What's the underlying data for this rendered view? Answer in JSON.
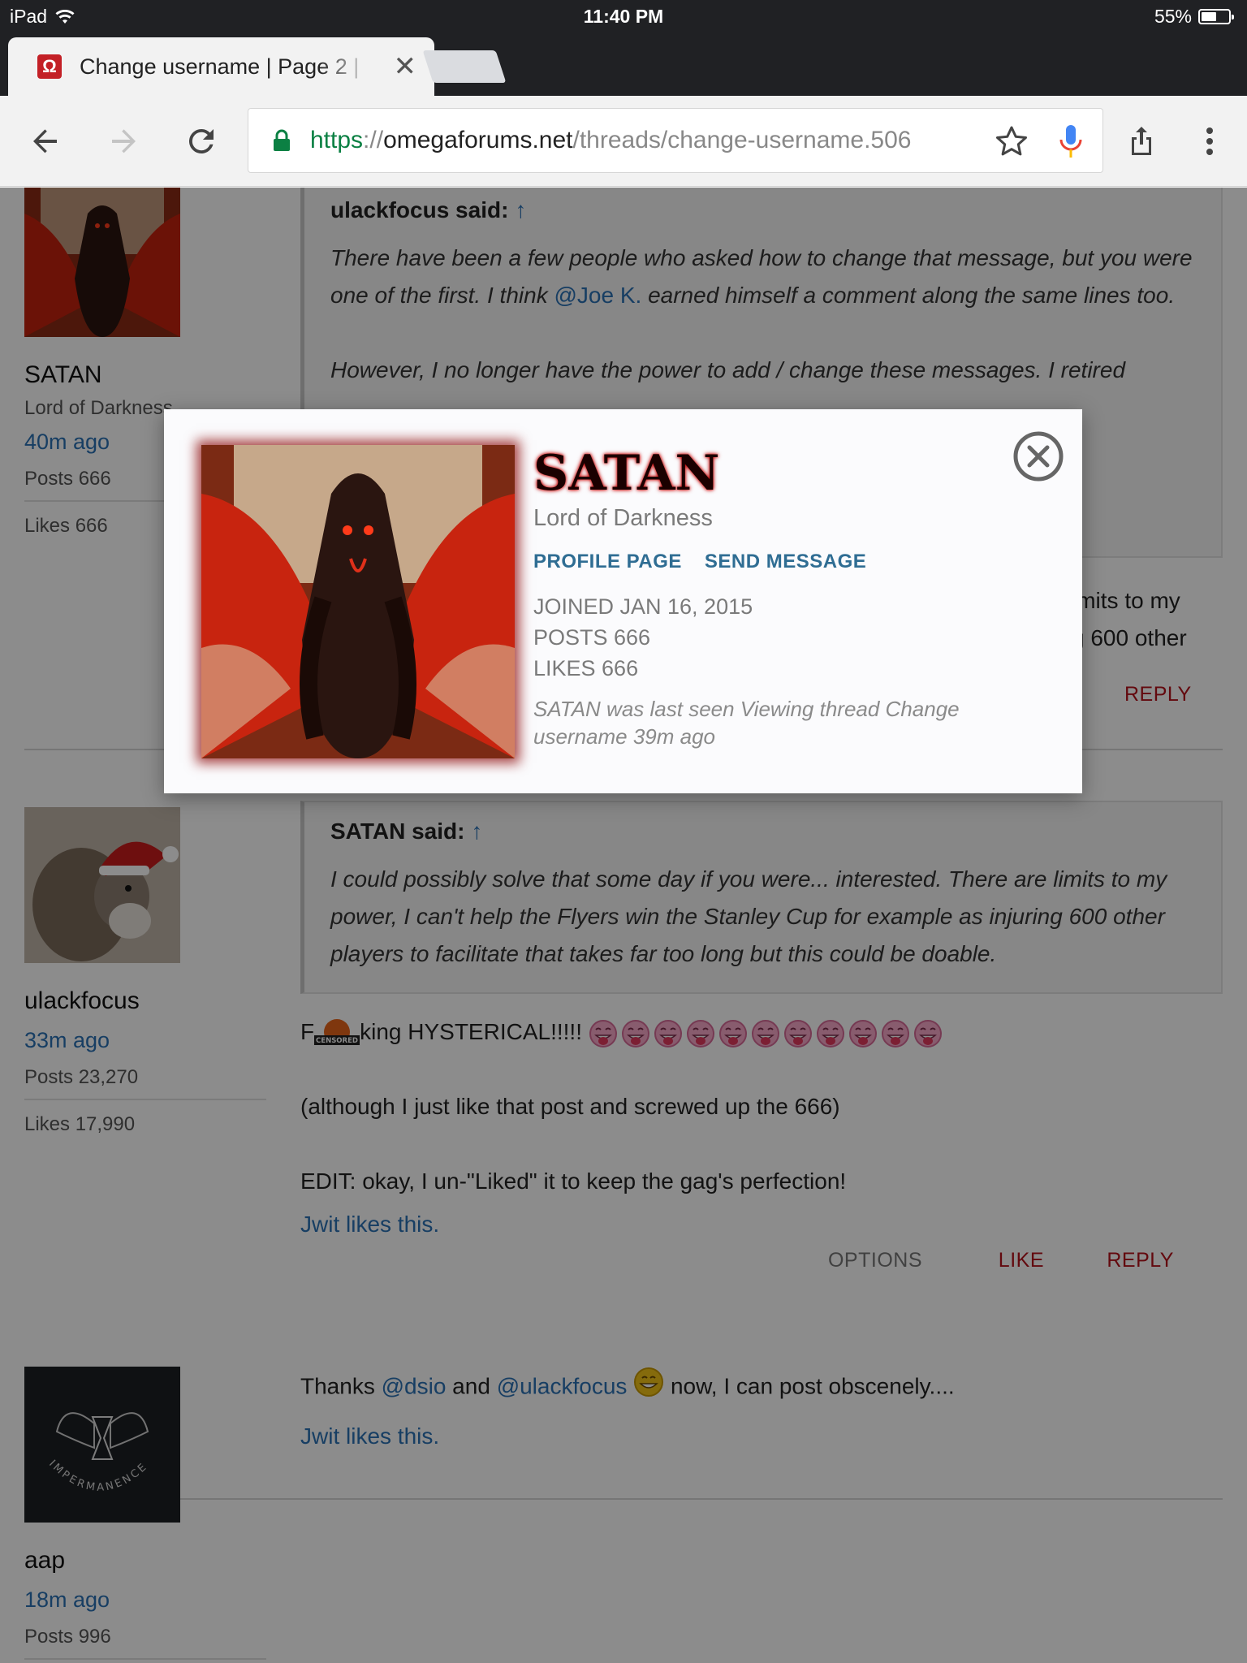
{
  "status_bar": {
    "device": "iPad",
    "time": "11:40 PM",
    "battery": "55%",
    "battery_level": 0.55
  },
  "browser": {
    "tab_title": "Change username | Page 2 |",
    "favicon": "Ω",
    "url_scheme": "https",
    "url_sep": "://",
    "url_host": "omegaforums.net",
    "url_path": "/threads/change-username.506"
  },
  "posts": [
    {
      "user": {
        "name": "SATAN",
        "title": "Lord of Darkness",
        "seen": "40m ago",
        "posts": "Posts 666",
        "likes": "Likes 666"
      },
      "quote": {
        "author": "ulackfocus said:",
        "arrow": "↑",
        "text_a": "There have been a few people who asked how to change that message, but you were one of the first. I think ",
        "mention": "@Joe K.",
        "text_b": " earned himself a comment along the same lines too.",
        "text_c": "However, I no longer have the power to add / change these messages. I retired"
      },
      "partial_line_1": "imits to my",
      "partial_line_2": "g 600 other",
      "reply": "REPLY"
    },
    {
      "user": {
        "name": "ulackfocus",
        "seen": "33m ago",
        "posts": "Posts 23,270",
        "likes": "Likes 17,990"
      },
      "quote": {
        "author": "SATAN said:",
        "arrow": "↑",
        "text": "I could possibly solve that some day if you were... interested. There are limits to my power, I can't help the Flyers win the Stanley Cup for example as injuring 600 other players to facilitate that takes far too long but this could be doable."
      },
      "line1_a": "F",
      "line1_badge": "CENSORED",
      "line1_b": "king HYSTERICAL!!!!!",
      "line2": "(although I just like that post and screwed up the 666)",
      "line3": "EDIT: okay, I un-\"Liked\" it to keep the gag's perfection!",
      "liker": "Jwit",
      "likes_text": " likes this.",
      "options": "OPTIONS",
      "like": "LIKE",
      "reply": "REPLY"
    },
    {
      "user": {
        "name": "aap",
        "seen": "18m ago",
        "posts": "Posts 996",
        "avatar_text": "IMPERMANENCE"
      },
      "text_a": "Thanks ",
      "mention_1": "@dsio",
      "text_b": " and ",
      "mention_2": "@ulackfocus",
      "text_c": " now, I can post obscenely....",
      "liker": "Jwit",
      "likes_text": " likes this."
    }
  ],
  "modal": {
    "name": "SATAN",
    "title": "Lord of Darkness",
    "link_profile": "PROFILE PAGE",
    "link_message": "SEND MESSAGE",
    "joined": "JOINED JAN 16, 2015",
    "posts": "POSTS 666",
    "likes": "LIKES 666",
    "seen": "SATAN was last seen Viewing thread Change username 39m ago"
  }
}
